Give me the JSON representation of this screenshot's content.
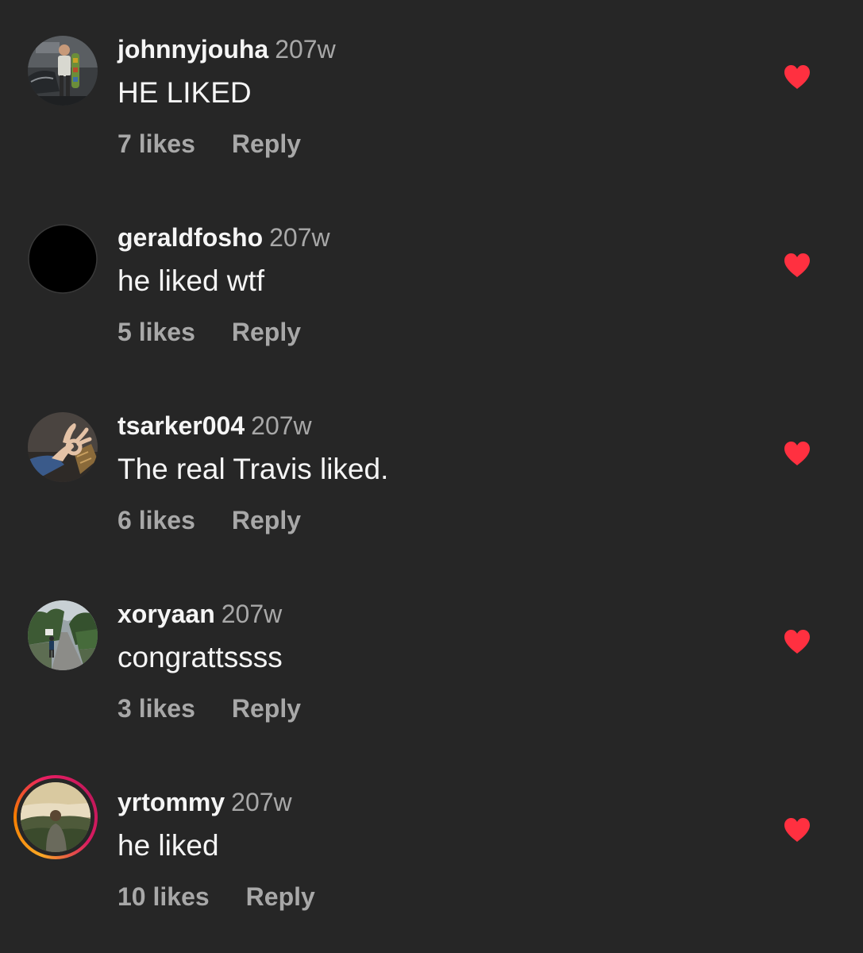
{
  "colors": {
    "background": "#262626",
    "primary_text": "#f5f5f5",
    "secondary_text": "#a8a8a8",
    "heart_red": "#ff3040"
  },
  "comments": [
    {
      "username": "johnnyjouha",
      "time": "207w",
      "text": "HE LIKED",
      "likes": "7 likes",
      "reply_label": "Reply",
      "liked": true,
      "avatar": "person-with-car-photo",
      "story_ring": false
    },
    {
      "username": "geraldfosho",
      "time": "207w",
      "text": "he liked wtf",
      "likes": "5 likes",
      "reply_label": "Reply",
      "liked": true,
      "avatar": "black-avatar",
      "story_ring": false
    },
    {
      "username": "tsarker004",
      "time": "207w",
      "text": "The real Travis liked.",
      "likes": "6 likes",
      "reply_label": "Reply",
      "liked": true,
      "avatar": "ok-hand-gesture-photo",
      "story_ring": false
    },
    {
      "username": "xoryaan",
      "time": "207w",
      "text": "congrattssss",
      "likes": "3 likes",
      "reply_label": "Reply",
      "liked": true,
      "avatar": "person-on-road-photo",
      "story_ring": false
    },
    {
      "username": "yrtommy",
      "time": "207w",
      "text": "he liked",
      "likes": "10 likes",
      "reply_label": "Reply",
      "liked": true,
      "avatar": "person-landscape-photo",
      "story_ring": true
    }
  ]
}
